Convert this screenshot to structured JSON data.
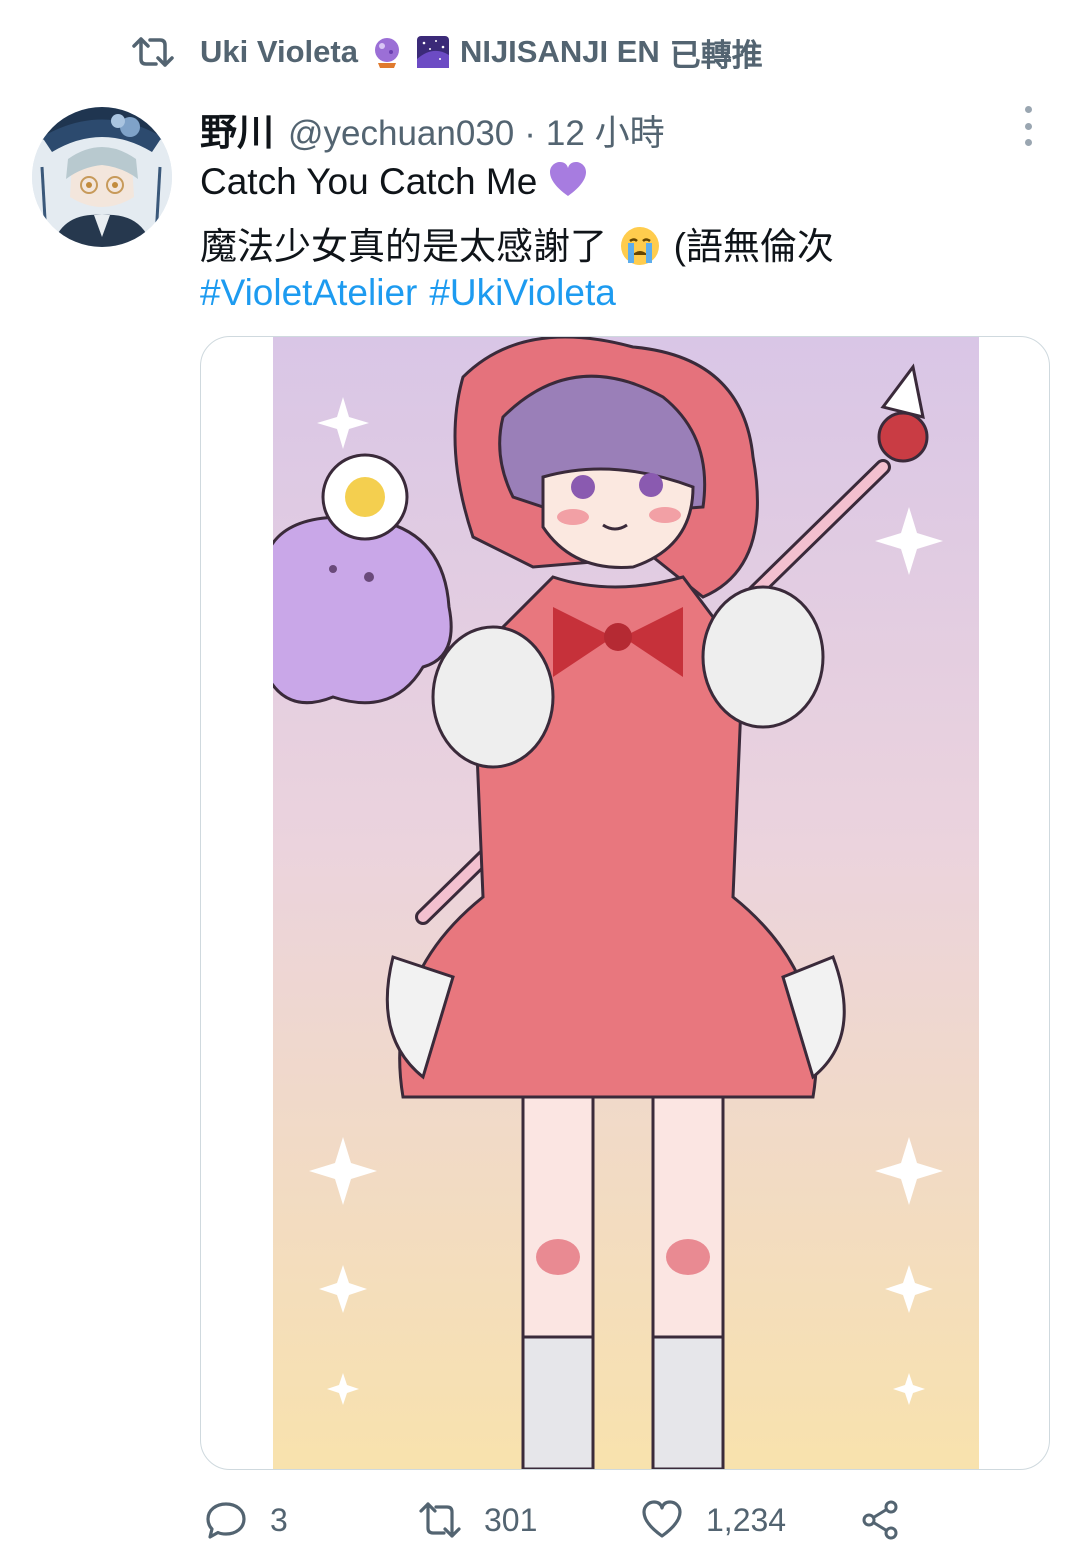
{
  "retweet": {
    "name": "Uki Violeta",
    "org": "NIJISANJI EN",
    "suffix": "已轉推"
  },
  "tweet": {
    "display_name": "野川",
    "handle": "@yechuan030",
    "separator": "·",
    "time": "12 小時",
    "line1": "Catch You Catch Me",
    "line2_text": "魔法少女真的是太感謝了",
    "line2_tail": "(語無倫次",
    "hashtags": [
      "#VioletAtelier",
      "#UkiVioleta"
    ]
  },
  "actions": {
    "reply_count": "3",
    "retweet_count": "301",
    "like_count": "1,234"
  },
  "icons": {
    "retweet": "retweet-icon",
    "more": "more-vertical-icon",
    "reply": "reply-icon",
    "like": "heart-icon",
    "share": "share-icon"
  },
  "colors": {
    "muted": "#536471",
    "link": "#1d9bf0",
    "text": "#0f1419"
  }
}
